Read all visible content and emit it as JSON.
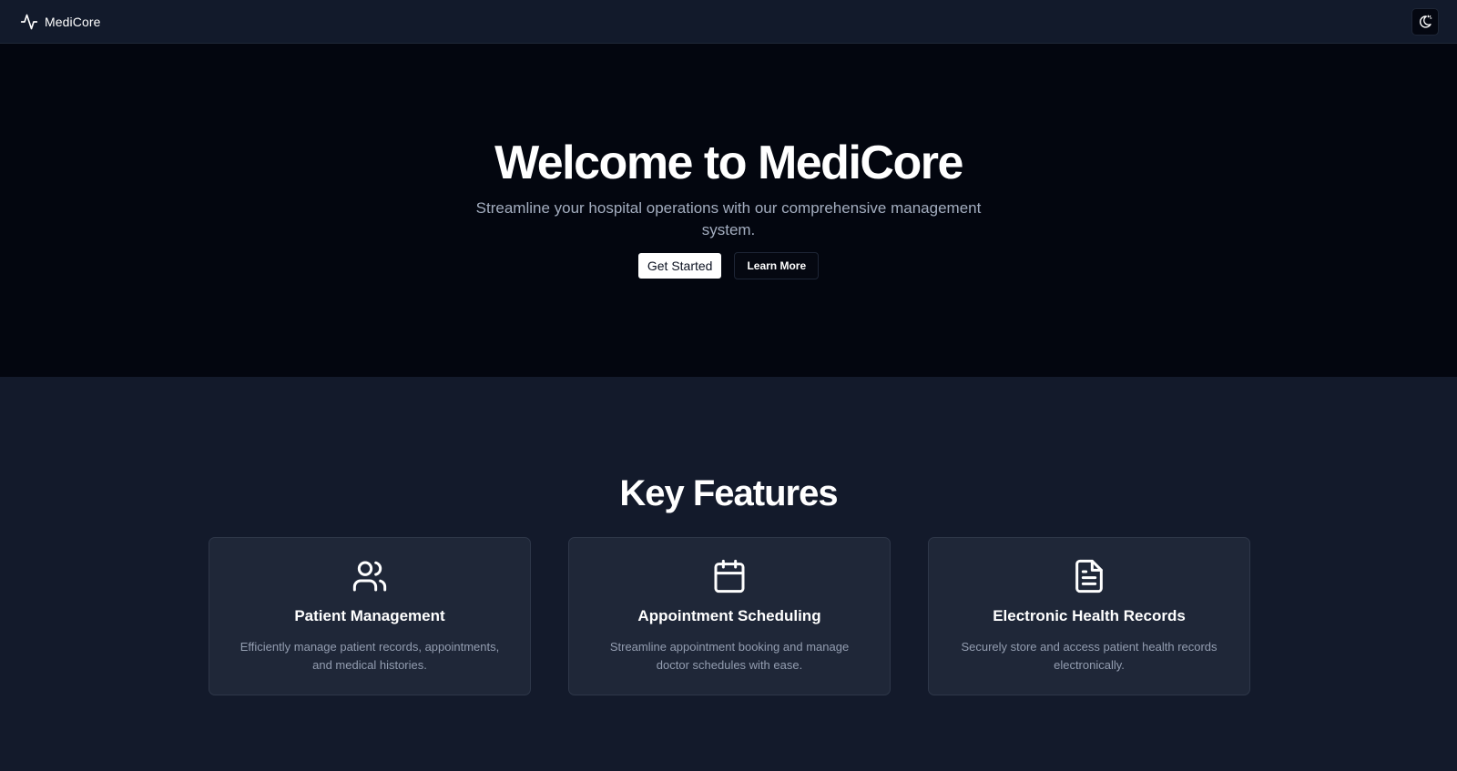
{
  "header": {
    "brand_name": "MediCore",
    "logo_icon": "activity-pulse-icon",
    "theme_toggle_icon": "moon-sun-icon"
  },
  "hero": {
    "title": "Welcome to MediCore",
    "subtitle": "Streamline your hospital operations with our comprehensive management system.",
    "primary_button": "Get Started",
    "secondary_button": "Learn More"
  },
  "features": {
    "title": "Key Features",
    "cards": [
      {
        "icon": "users-icon",
        "title": "Patient Management",
        "description": "Efficiently manage patient records, appointments, and medical histories."
      },
      {
        "icon": "calendar-icon",
        "title": "Appointment Scheduling",
        "description": "Streamline appointment booking and manage doctor schedules with ease."
      },
      {
        "icon": "file-text-icon",
        "title": "Electronic Health Records",
        "description": "Securely store and access patient health records electronically."
      }
    ]
  },
  "colors": {
    "header_bg": "#121a2b",
    "hero_bg": "#03060f",
    "section_bg": "#131a2b",
    "card_bg": "#1f2738",
    "text_primary": "#ffffff",
    "text_muted": "#939db0"
  }
}
